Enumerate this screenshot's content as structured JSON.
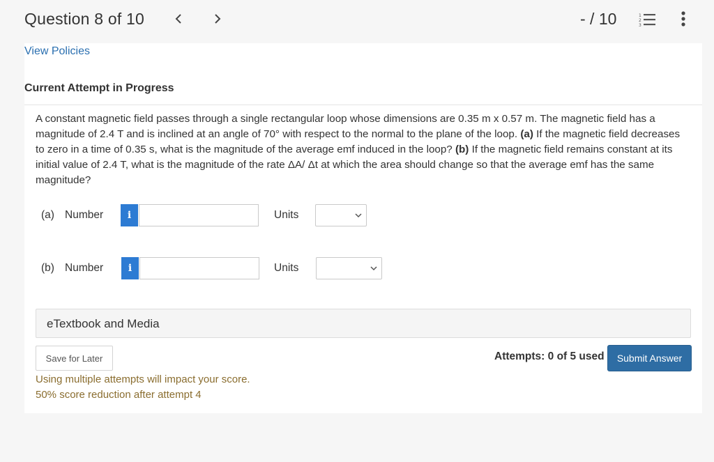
{
  "header": {
    "question_title": "Question 8 of 10",
    "score": "- / 10",
    "icons": {
      "prev": "chevron-left-icon",
      "next": "chevron-right-icon",
      "list": "numbered-list-icon",
      "more": "vertical-dots-icon"
    }
  },
  "links": {
    "view_policies": "View Policies"
  },
  "attempt": {
    "heading": "Current Attempt in Progress"
  },
  "question": {
    "seg1": "A constant magnetic field passes through a single rectangular loop whose dimensions are 0.35 m x 0.57 m. The magnetic field has a magnitude of 2.4 T and is inclined at an angle of 70° with respect to the normal to the plane of the loop. ",
    "part_a_marker": "(a)",
    "seg2": " If the magnetic field decreases to zero in a time of 0.35 s, what is the magnitude of the average emf induced in the loop? ",
    "part_b_marker": "(b)",
    "seg3": " If the magnetic field remains constant at its initial value of 2.4 T, what is the magnitude of the rate ΔA/ Δt at which the area should change so that the average emf has the same magnitude?"
  },
  "answers": [
    {
      "part": "(a)",
      "label": "Number",
      "info": "i",
      "value": "",
      "units_label": "Units",
      "units_selected": ""
    },
    {
      "part": "(b)",
      "label": "Number",
      "info": "i",
      "value": "",
      "units_label": "Units",
      "units_selected": ""
    }
  ],
  "etextbook": {
    "label": "eTextbook and Media"
  },
  "actions": {
    "save_label": "Save for Later",
    "attempts_text": "Attempts: 0 of 5 used",
    "submit_label": "Submit Answer"
  },
  "warnings": {
    "line1": "Using multiple attempts will impact your score.",
    "line2": "50% score reduction after attempt 4"
  },
  "colors": {
    "link": "#2a6fb0",
    "info_button": "#2d7bd3",
    "submit_button": "#2e6da4",
    "warning_text": "#8a6d2f"
  }
}
